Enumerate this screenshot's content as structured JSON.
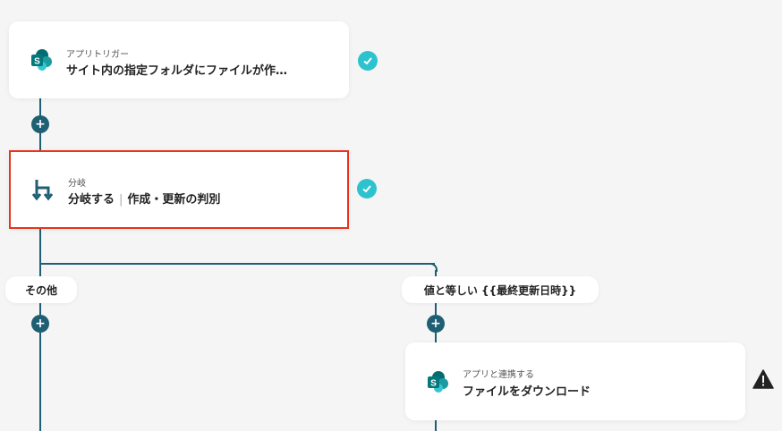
{
  "nodes": {
    "trigger": {
      "label": "アプリトリガー",
      "title": "サイト内の指定フォルダにファイルが作…"
    },
    "branch": {
      "label": "分岐",
      "title": "分岐する",
      "subtitle": "作成・更新の判別"
    },
    "download": {
      "label": "アプリと連携する",
      "title": "ファイルをダウンロード"
    }
  },
  "branches": {
    "left": "その他",
    "right": "値と等しい {{最終更新日時}}"
  },
  "icons": {
    "trigger": "sharepoint-icon",
    "branch": "branch-icon",
    "download": "sharepoint-icon",
    "status_ok": "check-icon",
    "status_warn": "warning-icon",
    "add": "plus-icon"
  },
  "colors": {
    "flow_line": "#1e5f74",
    "check": "#2cc3cf",
    "highlight": "#e8341c",
    "warning": "#222222",
    "sharepoint": "#038387"
  }
}
